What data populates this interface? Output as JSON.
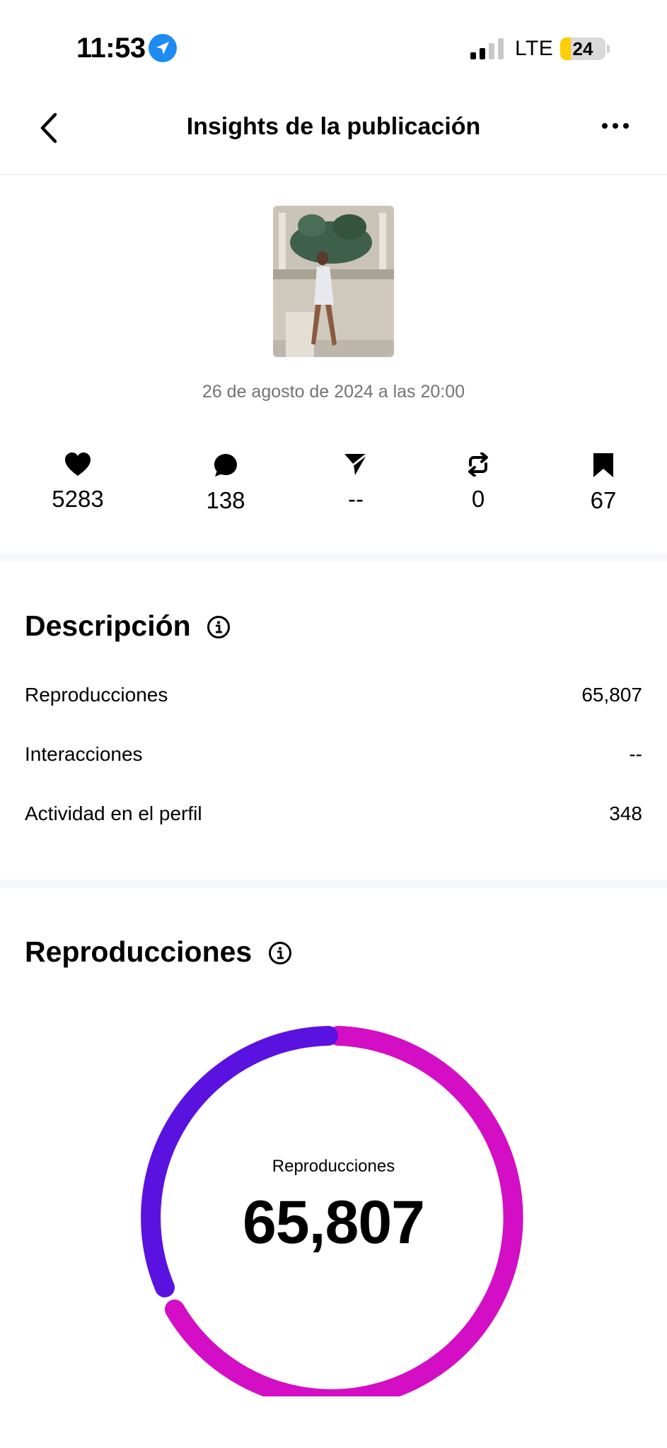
{
  "status_bar": {
    "time": "11:53",
    "network": "LTE",
    "battery": "24",
    "battery_level": 0.24
  },
  "header": {
    "title": "Insights de la publicación",
    "back_icon": "chevron-left-icon",
    "more_icon": "more-horizontal-icon"
  },
  "post": {
    "date": "26 de agosto de 2024 a las 20:00"
  },
  "stats": [
    {
      "icon": "heart-icon",
      "value": "5283"
    },
    {
      "icon": "comment-icon",
      "value": "138"
    },
    {
      "icon": "share-icon",
      "value": "--"
    },
    {
      "icon": "repost-icon",
      "value": "0"
    },
    {
      "icon": "bookmark-icon",
      "value": "67"
    }
  ],
  "overview": {
    "title": "Descripción",
    "rows": [
      {
        "label": "Reproducciones",
        "value": "65,807"
      },
      {
        "label": "Interacciones",
        "value": "--"
      },
      {
        "label": "Actividad en el perfil",
        "value": "348"
      }
    ]
  },
  "views": {
    "title": "Reproducciones",
    "donut_label": "Reproducciones",
    "donut_value": "65,807",
    "colors": {
      "segment_a": "#5a12e0",
      "segment_b": "#d30ec4"
    }
  }
}
